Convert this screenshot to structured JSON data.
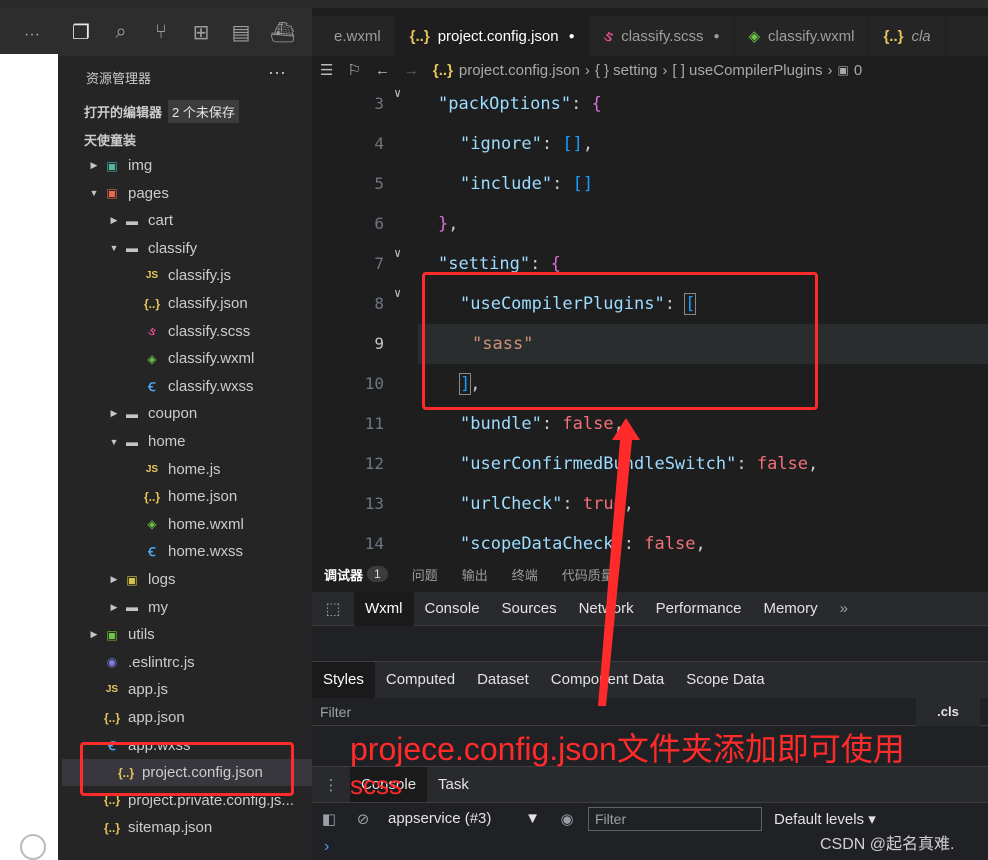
{
  "left_strip": {
    "more": "···"
  },
  "explorer": {
    "title": "资源管理器",
    "more": "···",
    "open_editors": {
      "label": "打开的编辑器",
      "badge": "2 个未保存"
    },
    "project": {
      "label": "天使童装"
    },
    "tree": [
      {
        "name": "img",
        "type": "img",
        "depth": 1,
        "arrow": "▶"
      },
      {
        "name": "pages",
        "type": "pages",
        "depth": 1,
        "arrow": "▼"
      },
      {
        "name": "cart",
        "type": "folder",
        "depth": 2,
        "arrow": "▶"
      },
      {
        "name": "classify",
        "type": "folder",
        "depth": 2,
        "arrow": "▼"
      },
      {
        "name": "classify.js",
        "type": "js",
        "depth": 3,
        "arrow": ""
      },
      {
        "name": "classify.json",
        "type": "json",
        "depth": 3,
        "arrow": ""
      },
      {
        "name": "classify.scss",
        "type": "scss",
        "depth": 3,
        "arrow": ""
      },
      {
        "name": "classify.wxml",
        "type": "wxml",
        "depth": 3,
        "arrow": ""
      },
      {
        "name": "classify.wxss",
        "type": "wxss",
        "depth": 3,
        "arrow": ""
      },
      {
        "name": "coupon",
        "type": "folder",
        "depth": 2,
        "arrow": "▶"
      },
      {
        "name": "home",
        "type": "folder",
        "depth": 2,
        "arrow": "▼"
      },
      {
        "name": "home.js",
        "type": "js",
        "depth": 3,
        "arrow": ""
      },
      {
        "name": "home.json",
        "type": "json",
        "depth": 3,
        "arrow": ""
      },
      {
        "name": "home.wxml",
        "type": "wxml",
        "depth": 3,
        "arrow": ""
      },
      {
        "name": "home.wxss",
        "type": "wxss",
        "depth": 3,
        "arrow": ""
      },
      {
        "name": "logs",
        "type": "logs",
        "depth": 2,
        "arrow": "▶"
      },
      {
        "name": "my",
        "type": "folder",
        "depth": 2,
        "arrow": "▶"
      },
      {
        "name": "utils",
        "type": "utils",
        "depth": 1,
        "arrow": "▶"
      },
      {
        "name": ".eslintrc.js",
        "type": "eslint",
        "depth": 1,
        "arrow": ""
      },
      {
        "name": "app.js",
        "type": "js",
        "depth": 1,
        "arrow": ""
      },
      {
        "name": "app.json",
        "type": "json",
        "depth": 1,
        "arrow": ""
      },
      {
        "name": "app.wxss",
        "type": "wxss",
        "depth": 1,
        "arrow": ""
      },
      {
        "name": "project.config.json",
        "type": "json",
        "depth": 1,
        "arrow": "",
        "selected": true
      },
      {
        "name": "project.private.config.js...",
        "type": "json",
        "depth": 1,
        "arrow": ""
      },
      {
        "name": "sitemap.json",
        "type": "json",
        "depth": 1,
        "arrow": ""
      }
    ]
  },
  "tabs": [
    {
      "label": "e.wxml",
      "icon": "",
      "dot": ""
    },
    {
      "label": "project.config.json",
      "icon": "{..}",
      "dot": "●",
      "active": true
    },
    {
      "label": "classify.scss",
      "icon": "ઙ",
      "dot": "●"
    },
    {
      "label": "classify.wxml",
      "icon": "◈",
      "dot": ""
    },
    {
      "label": "cla",
      "icon": "{..}",
      "dot": ""
    }
  ],
  "breadcrumb": {
    "file": "project.config.json",
    "sep1": "›",
    "obj": "{ } setting",
    "sep2": "›",
    "arr": "[ ] useCompilerPlugins",
    "sep3": "›",
    "count": "0"
  },
  "editor": {
    "lines": [
      {
        "n": "3",
        "fold": "∨"
      },
      {
        "n": "4",
        "fold": ""
      },
      {
        "n": "5",
        "fold": ""
      },
      {
        "n": "6",
        "fold": ""
      },
      {
        "n": "7",
        "fold": "∨"
      },
      {
        "n": "8",
        "fold": "∨"
      },
      {
        "n": "9",
        "fold": "",
        "current": true
      },
      {
        "n": "10",
        "fold": ""
      },
      {
        "n": "11",
        "fold": ""
      },
      {
        "n": "12",
        "fold": ""
      },
      {
        "n": "13",
        "fold": ""
      },
      {
        "n": "14",
        "fold": ""
      }
    ],
    "code": {
      "l3_key": "\"packOptions\"",
      "l3_rest": ": ",
      "l3_brace": "{",
      "l4_key": "\"ignore\"",
      "l4_rest": ": ",
      "l4_val": "[]",
      "l4_end": ",",
      "l5_key": "\"include\"",
      "l5_rest": ": ",
      "l5_val": "[]",
      "l6_brace": "}",
      "l6_end": ",",
      "l7_key": "\"setting\"",
      "l7_rest": ": ",
      "l7_brace": "{",
      "l8_key": "\"useCompilerPlugins\"",
      "l8_rest": ": ",
      "l8_br": "[",
      "l9_val": "\"sass\"",
      "l10_br": "]",
      "l10_end": ",",
      "l11_key": "\"bundle\"",
      "l11_rest": ": ",
      "l11_val": "false",
      "l11_end": ",",
      "l12_key": "\"userConfirmedBundleSwitch\"",
      "l12_rest": ": ",
      "l12_val": "false",
      "l12_end": ",",
      "l13_key": "\"urlCheck\"",
      "l13_rest": ": ",
      "l13_val": "true",
      "l13_end": ",",
      "l14_key": "\"scopeDataCheck\"",
      "l14_rest": ": ",
      "l14_val": "false",
      "l14_end": ","
    }
  },
  "panel_tabs": {
    "debugger": "调试器",
    "badge": "1",
    "problems": "问题",
    "output": "输出",
    "terminal": "终端",
    "quality": "代码质量"
  },
  "devtools_tabs": [
    "Wxml",
    "Console",
    "Sources",
    "Network",
    "Performance",
    "Memory"
  ],
  "devtools_more": "»",
  "styles_tabs": [
    "Styles",
    "Computed",
    "Dataset",
    "Component Data",
    "Scope Data"
  ],
  "filter": {
    "placeholder": "Filter",
    "cls": ".cls"
  },
  "annotation": {
    "line1": "projece.config.json文件夹添加即可使用",
    "line2": "scss"
  },
  "console_tabs": [
    "Console",
    "Task"
  ],
  "console_toolbar": {
    "context": "appservice (#3)",
    "filter": "Filter",
    "levels": "Default levels ▾"
  },
  "prompt": "›",
  "watermark": "CSDN @起名真难.",
  "colors": {
    "annotation": "#ff2a2a",
    "editor_bg": "#1e1e1e"
  }
}
